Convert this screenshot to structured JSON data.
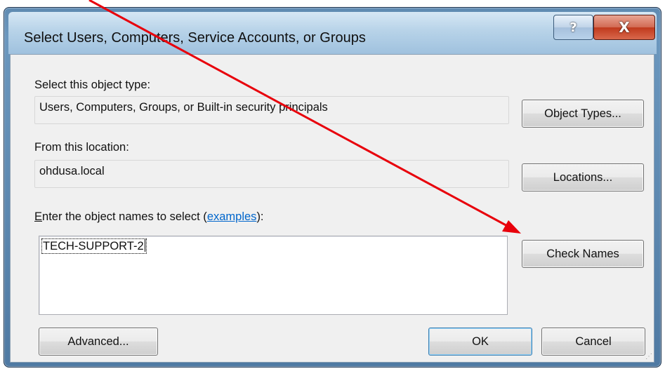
{
  "window": {
    "title": "Select Users, Computers, Service Accounts, or Groups",
    "help_glyph": "?",
    "close_glyph": "X"
  },
  "object_type": {
    "label": "Select this object type:",
    "value": "Users, Computers, Groups, or Built-in security principals",
    "button": "Object Types..."
  },
  "location": {
    "label": "From this location:",
    "value": "ohdusa.local",
    "button": "Locations..."
  },
  "names": {
    "label_mnemonic": "E",
    "label_prefix": "nter the object names to select (",
    "label_link": "examples",
    "label_suffix": "):",
    "value": "TECH-SUPPORT-2",
    "check_button": "Check Names"
  },
  "footer": {
    "advanced_button": "Advanced...",
    "ok_button": "OK",
    "cancel_button": "Cancel"
  },
  "annotation": {
    "color": "#e8000b"
  }
}
